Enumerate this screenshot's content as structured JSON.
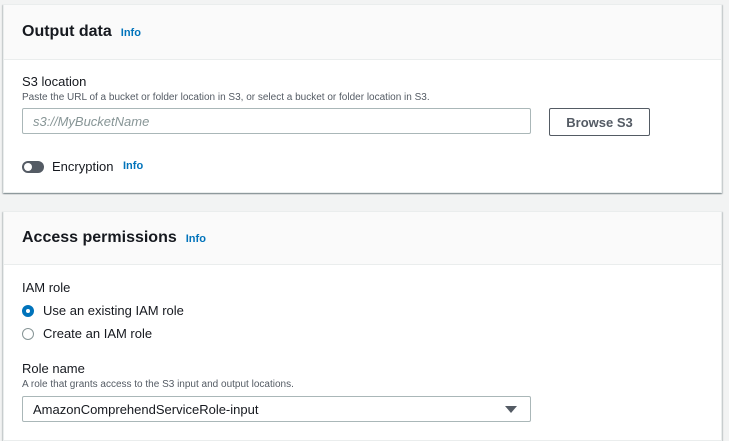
{
  "output_data": {
    "title": "Output data",
    "info": "Info",
    "s3_location": {
      "label": "S3 location",
      "description": "Paste the URL of a bucket or folder location in S3, or select a bucket or folder location in S3.",
      "placeholder": "s3://MyBucketName",
      "value": "",
      "browse_label": "Browse S3"
    },
    "encryption": {
      "label": "Encryption",
      "info": "Info",
      "enabled": false
    }
  },
  "access_permissions": {
    "title": "Access permissions",
    "info": "Info",
    "iam_role": {
      "label": "IAM role",
      "options": [
        {
          "label": "Use an existing IAM role",
          "selected": true
        },
        {
          "label": "Create an IAM role",
          "selected": false
        }
      ]
    },
    "role_name": {
      "label": "Role name",
      "description": "A role that grants access to the S3 input and output locations.",
      "selected_value": "AmazonComprehendServiceRole-input"
    }
  },
  "colors": {
    "accent": "#0073bb",
    "text": "#16191f",
    "secondary_text": "#545b64",
    "background": "#f2f3f3"
  }
}
